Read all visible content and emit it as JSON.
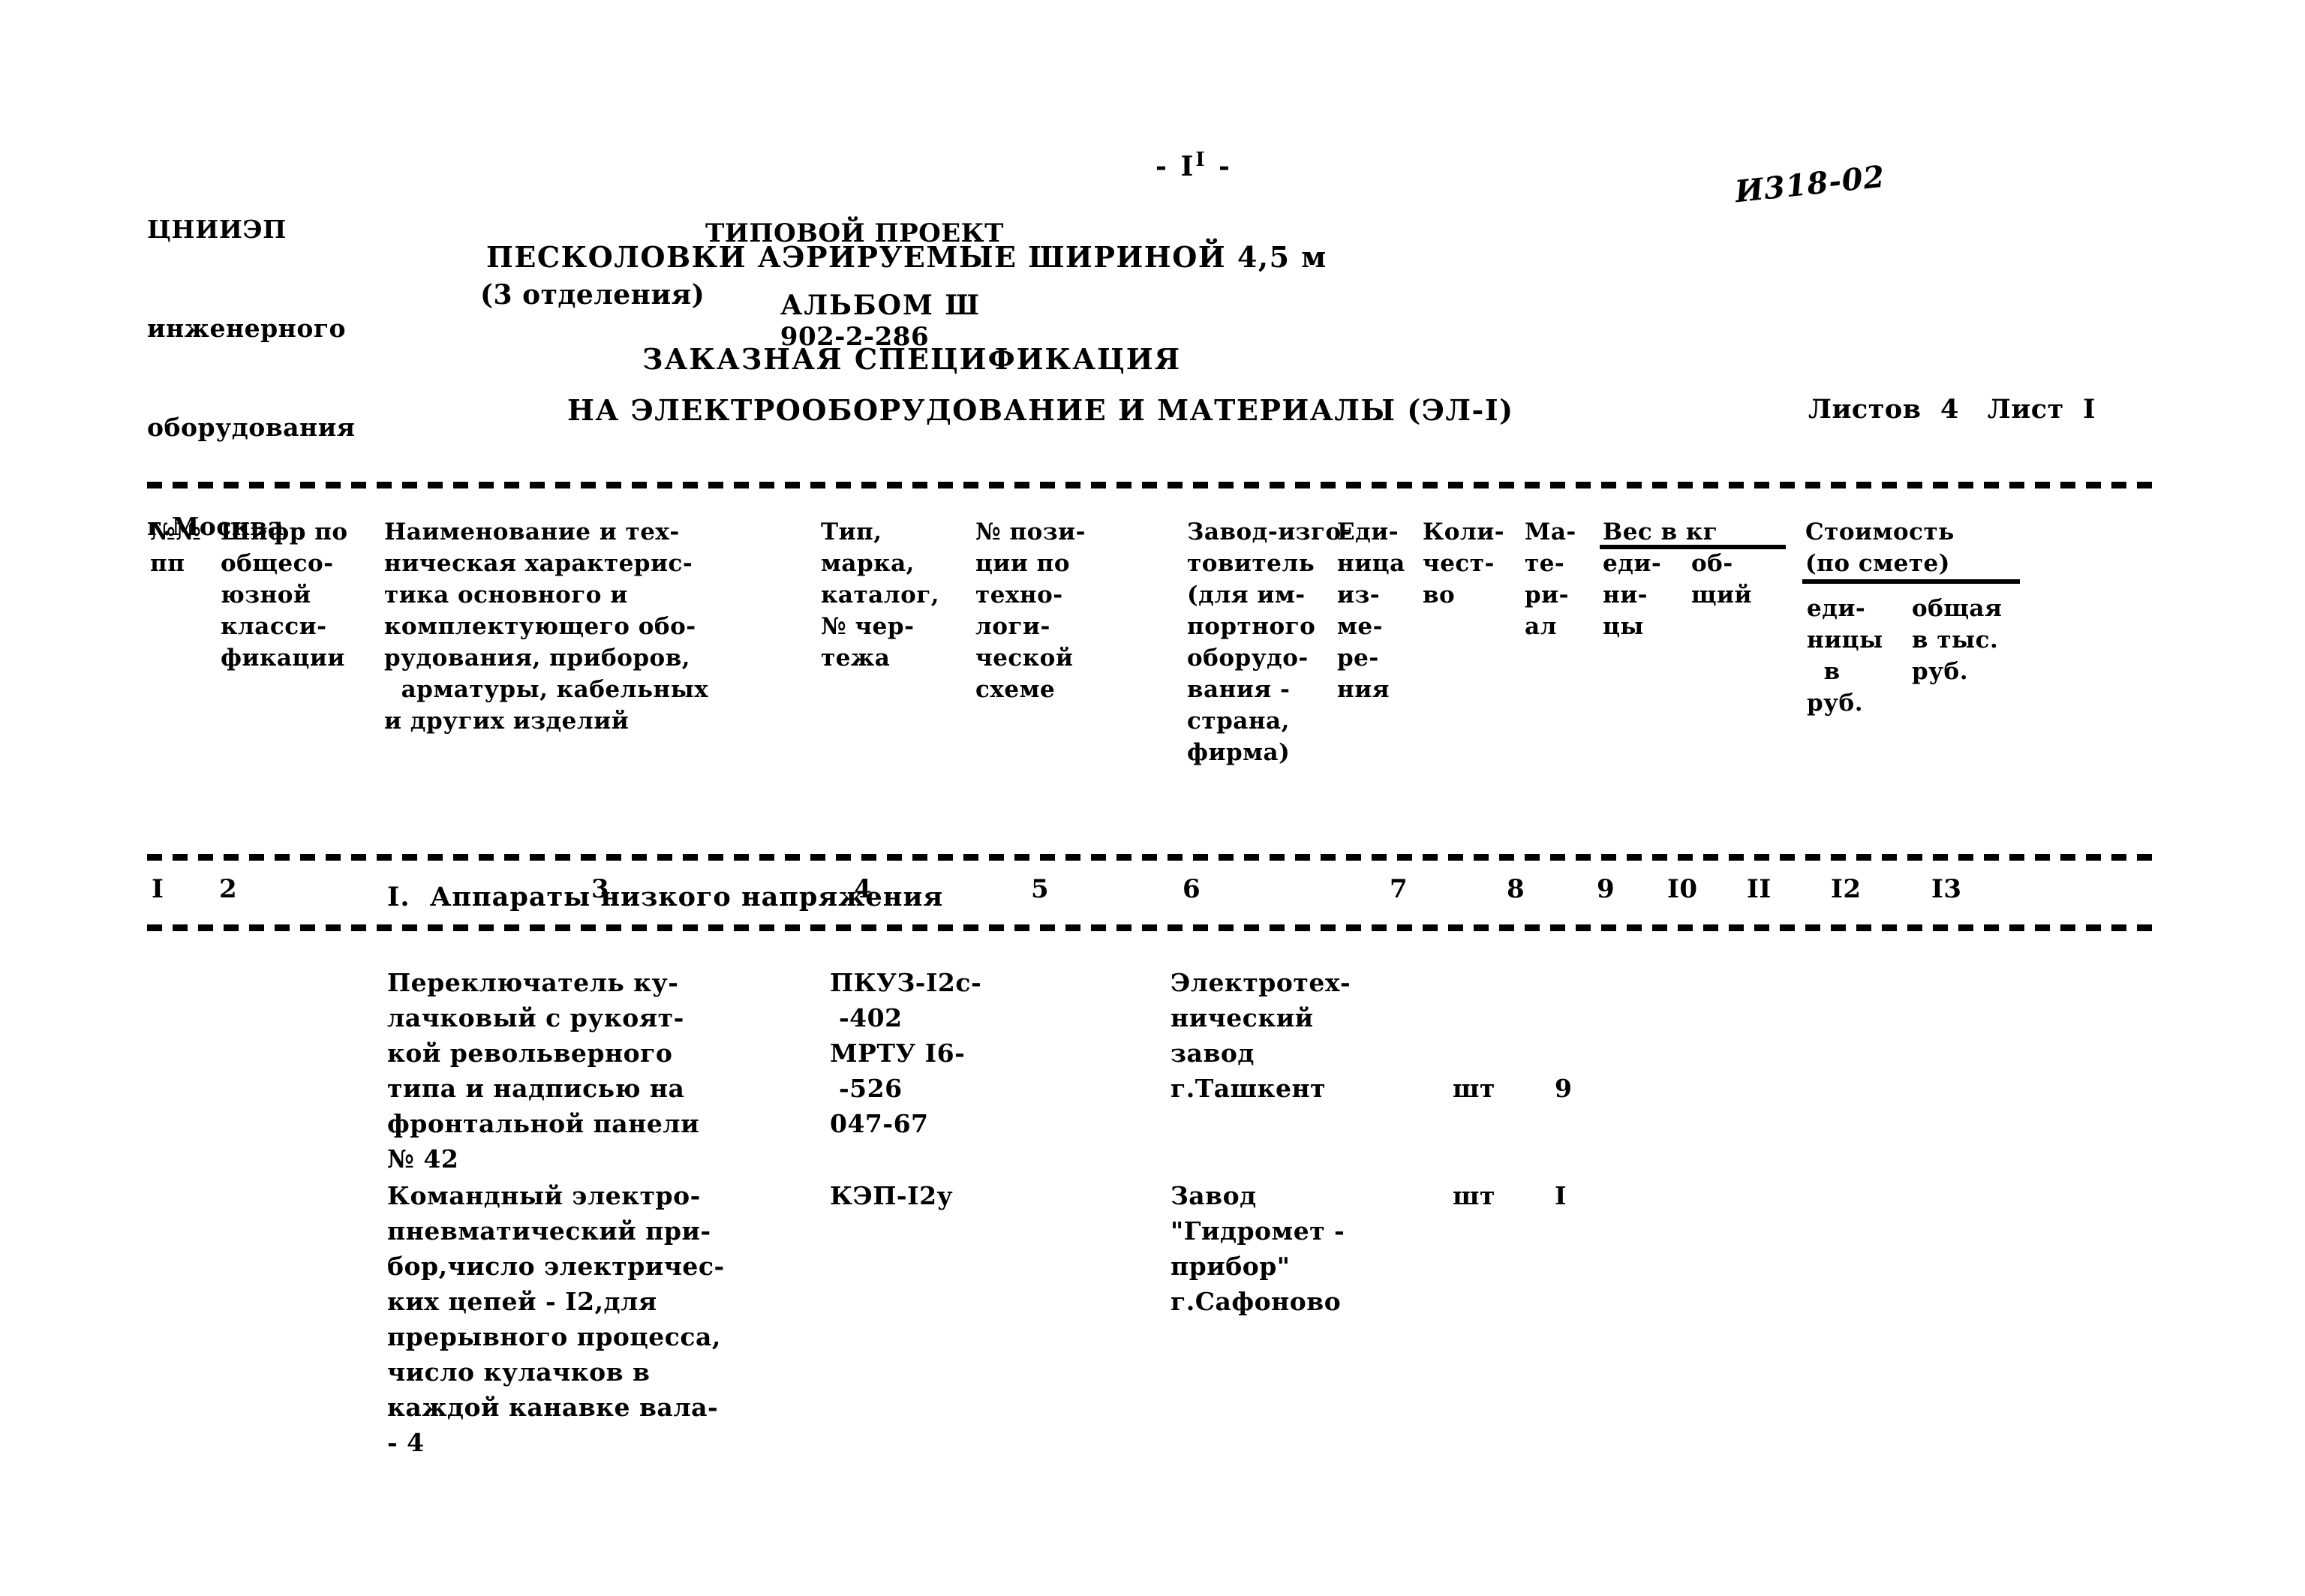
{
  "header": {
    "org": [
      "ЦНИИЭП",
      "инженерного",
      "оборудования",
      "г.Москва"
    ],
    "project_label": "ТИПОВОЙ ПРОЕКТ",
    "project_number": "902-2-286",
    "page_marker": "- I",
    "page_marker_sup": "I",
    "page_marker_end": " -",
    "hand_note": "И318-02",
    "title_line1": "ПЕСКОЛОВКИ АЭРИРУЕМЫЕ ШИРИНОЙ 4,5 м",
    "title_line2": "(3 отделения)",
    "album": "АЛЬБОМ Ш",
    "doc_type": "ЗАКАЗНАЯ СПЕЦИФИКАЦИЯ",
    "doc_subject": "НА ЭЛЕКТРООБОРУДОВАНИЕ И МАТЕРИАЛЫ (ЭЛ-I)",
    "sheets_total_label": "Листов",
    "sheets_total": "4",
    "sheet_label": "Лист",
    "sheet_number": "I"
  },
  "table": {
    "headers": {
      "c1": "№№\nпп",
      "c2": "Шифр по\nобщесо-\nюзной\nкласси-\nфикации",
      "c3": "Наименование и тех-\nническая характерис-\nтика основного и\nкомплектующего обо-\nрудования, приборов,\n  арматуры, кабельных\nи других изделий",
      "c4": "Тип,\nмарка,\nкаталог,\n№ чер-\nтежа",
      "c5": "№ пози-\nции по\nтехно-\nлоги-\nческой\nсхеме",
      "c6": "Завод-изго-\nтовитель\n(для им-\nпортного\nоборудо-\nвания -\nстрана,\nфирма)",
      "c7": "Еди-\nница\nиз-\nме-\nре-\nния",
      "c8": "Коли-\nчест-\nво",
      "c9": "Ма-\nте-\nри-\nал",
      "c10_group": "Вес в кг",
      "c10": "еди-\nни-\nцы",
      "c11": "об-\nщий",
      "c12_group": "Стоимость\n(по смете)",
      "c12": "еди-\nницы\n  в\nруб.",
      "c13": "общая\nв тыс.\nруб."
    },
    "column_numbers": [
      "I",
      "2",
      "3",
      "4",
      "5",
      "6",
      "7",
      "8",
      "9",
      "I0",
      "II",
      "I2",
      "I3"
    ],
    "sections": [
      {
        "title": "I.  Аппараты низкого напряжения",
        "rows": [
          {
            "name": "Переключатель ку-\nлачковый с рукоят-\nкой револьверного\nтипа и надписью на\nфронтальной панели\n№ 42",
            "type": "ПКУЗ-I2с-\n -402\nМРТУ I6-\n -526\n047-67",
            "position": "",
            "manufacturer": "Электротех-\nнический\nзавод\nг.Ташкент",
            "unit": "шт",
            "quantity": "9",
            "material": "",
            "weight_unit": "",
            "weight_total": "",
            "cost_unit": "",
            "cost_total": ""
          },
          {
            "name": "Командный электро-\nпневматический при-\nбор,число электричес-\nких цепей - I2,для\nпрерывного процесса,\nчисло кулачков в\nкаждой канавке вала-\n- 4",
            "type": "КЭП-I2у",
            "position": "",
            "manufacturer": "Завод\n\"Гидромет -\nприбор\"\nг.Сафоново",
            "unit": "шт",
            "quantity": "I",
            "material": "",
            "weight_unit": "",
            "weight_total": "",
            "cost_unit": "",
            "cost_total": ""
          }
        ]
      }
    ]
  }
}
